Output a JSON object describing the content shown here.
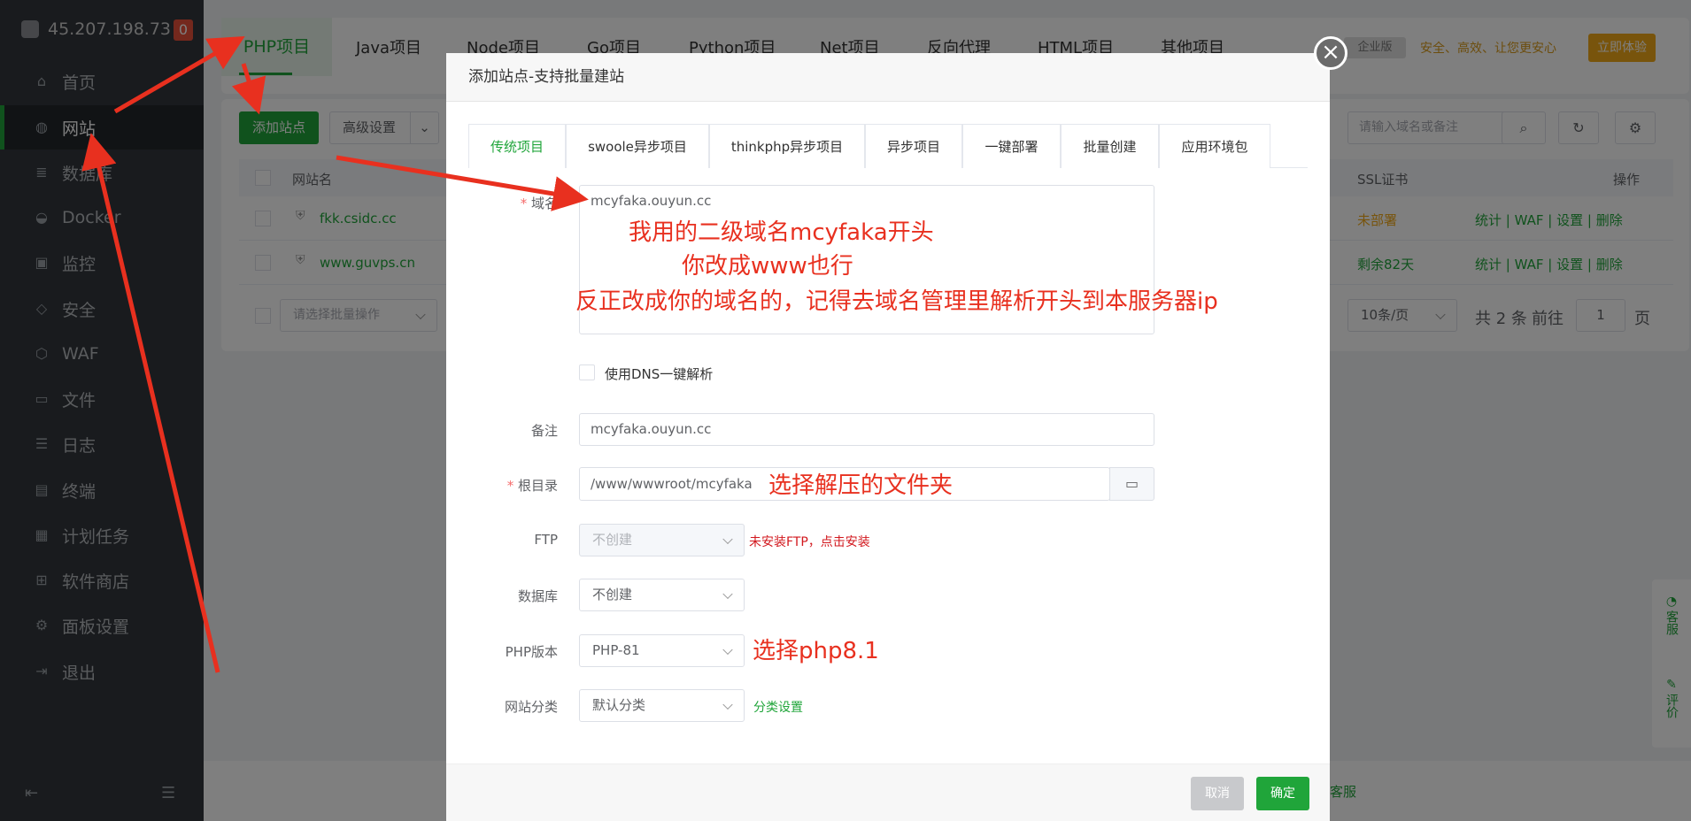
{
  "sidebar": {
    "server_ip": "45.207.198.73",
    "badge": "0",
    "items": [
      {
        "label": "首页",
        "icon": "home-icon"
      },
      {
        "label": "网站",
        "icon": "globe-icon"
      },
      {
        "label": "数据库",
        "icon": "database-icon"
      },
      {
        "label": "Docker",
        "icon": "docker-icon"
      },
      {
        "label": "监控",
        "icon": "monitor-icon"
      },
      {
        "label": "安全",
        "icon": "shield-icon"
      },
      {
        "label": "WAF",
        "icon": "waf-icon"
      },
      {
        "label": "文件",
        "icon": "folder-icon"
      },
      {
        "label": "日志",
        "icon": "log-icon"
      },
      {
        "label": "终端",
        "icon": "terminal-icon"
      },
      {
        "label": "计划任务",
        "icon": "calendar-icon"
      },
      {
        "label": "软件商店",
        "icon": "grid-icon"
      },
      {
        "label": "面板设置",
        "icon": "gear-icon"
      },
      {
        "label": "退出",
        "icon": "logout-icon"
      }
    ]
  },
  "topnav": {
    "tabs": [
      "PHP项目",
      "Java项目",
      "Node项目",
      "Go项目",
      "Python项目",
      "Net项目",
      "反向代理",
      "HTML项目",
      "其他项目"
    ],
    "enterprise": "企业版",
    "promo": "安全、高效、让您更安心",
    "trial": "立即体验"
  },
  "toolbar": {
    "add_site": "添加站点",
    "advanced": "高级设置",
    "search_placeholder": "请输入域名或备注"
  },
  "table": {
    "headers": {
      "name": "网站名",
      "ssl": "SSL证书",
      "ops": "操作"
    },
    "rows": [
      {
        "name": "fkk.csidc.cc",
        "ssl": "未部署",
        "ops": [
          "统计",
          "WAF",
          "设置",
          "删除"
        ]
      },
      {
        "name": "www.guvps.cn",
        "ssl": "剩余82天",
        "ops": [
          "统计",
          "WAF",
          "设置",
          "删除"
        ]
      }
    ],
    "batch_placeholder": "请选择批量操作",
    "page_size": "10条/页",
    "total": "共 2 条",
    "goto": "前往",
    "page": "1",
    "page_unit": "页"
  },
  "dialog": {
    "title": "添加站点-支持批量建站",
    "tabs": [
      "传统项目",
      "swoole异步项目",
      "thinkphp异步项目",
      "异步项目",
      "一键部署",
      "批量创建",
      "应用环境包"
    ],
    "domain_label": "域名",
    "domain_value": "mcyfaka.ouyun.cc",
    "dns_label": "使用DNS一键解析",
    "remark_label": "备注",
    "remark_value": "mcyfaka.ouyun.cc",
    "root_label": "根目录",
    "root_value": "/www/wwwroot/mcyfaka",
    "ftp_label": "FTP",
    "ftp_value": "不创建",
    "ftp_note": "未安装FTP，点击安装",
    "db_label": "数据库",
    "db_value": "不创建",
    "php_label": "PHP版本",
    "php_value": "PHP-81",
    "category_label": "网站分类",
    "category_value": "默认分类",
    "category_link": "分类设置",
    "cancel": "取消",
    "confirm": "确定"
  },
  "annotations": {
    "domain_1": "我用的二级域名mcyfaka开头",
    "domain_2": "你改成www也行",
    "domain_3": "反正改成你的域名的，记得去域名管理里解析开头到本服务器ip",
    "root": "选择解压的文件夹",
    "php": "选择php8.1"
  },
  "side_widget": {
    "service": "客服",
    "review": "评价"
  },
  "footer_text": "客服",
  "colors": {
    "accent": "#20a53a",
    "annotation": "#e8301f",
    "sidebar": "#33373d"
  }
}
